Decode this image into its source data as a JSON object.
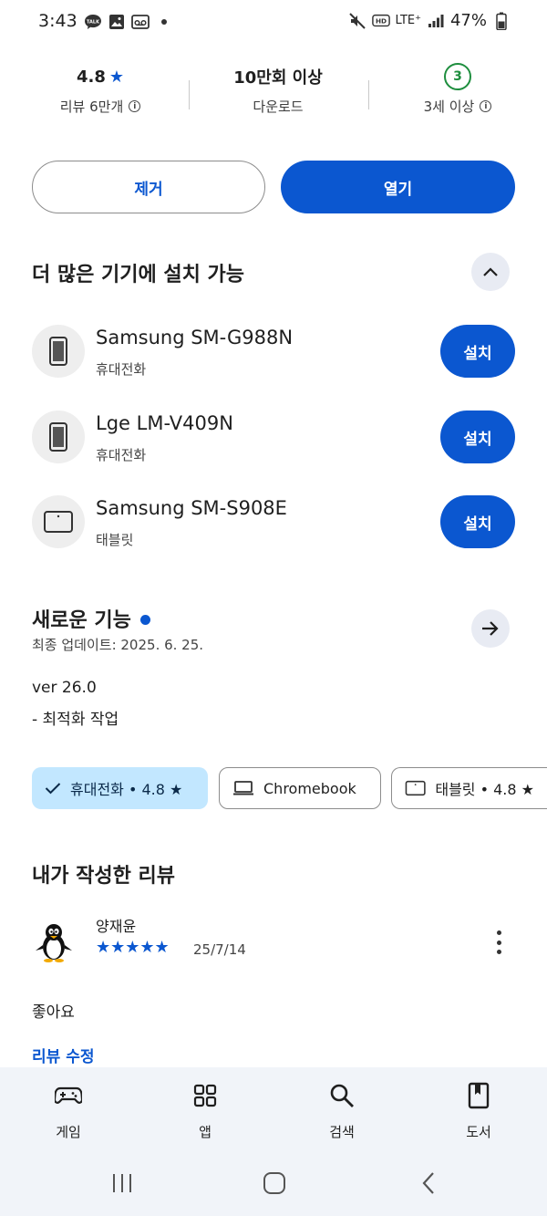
{
  "status": {
    "time": "3:43",
    "battery": "47%",
    "network": "LTE⁺"
  },
  "stats": {
    "rating": "4.8",
    "rating_sub": "리뷰 6만개",
    "downloads": "10만회 이상",
    "downloads_sub": "다운로드",
    "age_badge": "3",
    "age_sub": "3세 이상"
  },
  "actions": {
    "remove": "제거",
    "open": "열기"
  },
  "more_devices": {
    "title": "더 많은 기기에 설치 가능",
    "devices": [
      {
        "name": "Samsung SM-G988N",
        "type": "휴대전화",
        "button": "설치",
        "icon": "phone-icon"
      },
      {
        "name": "Lge LM-V409N",
        "type": "휴대전화",
        "button": "설치",
        "icon": "phone-icon"
      },
      {
        "name": "Samsung SM-S908E",
        "type": "태블릿",
        "button": "설치",
        "icon": "tablet-icon"
      }
    ]
  },
  "whats_new": {
    "title": "새로운 기능",
    "updated": "최종 업데이트: 2025. 6. 25.",
    "version": "ver 26.0",
    "note": "- 최적화 작업"
  },
  "chips": [
    {
      "label": "휴대전화 • 4.8 ★",
      "selected": true,
      "icon": "check-icon"
    },
    {
      "label": "Chromebook",
      "selected": false,
      "icon": "laptop-icon"
    },
    {
      "label": "태블릿 • 4.8 ★",
      "selected": false,
      "icon": "tablet-icon"
    }
  ],
  "my_review": {
    "title": "내가 작성한 리뷰",
    "reviewer": "양재윤",
    "stars": "★★★★★",
    "star_count": 5,
    "date": "25/7/14",
    "text": "좋아요",
    "edit_link": "리뷰 수정"
  },
  "bottom_nav": [
    {
      "label": "게임",
      "icon": "gamepad-icon"
    },
    {
      "label": "앱",
      "icon": "apps-grid-icon"
    },
    {
      "label": "검색",
      "icon": "search-icon"
    },
    {
      "label": "도서",
      "icon": "book-icon"
    }
  ],
  "colors": {
    "accent": "#0b57d0",
    "chip_selected": "#c2e7ff",
    "age_green": "#1e8e3e",
    "nav_bg": "#f1f4f9"
  }
}
